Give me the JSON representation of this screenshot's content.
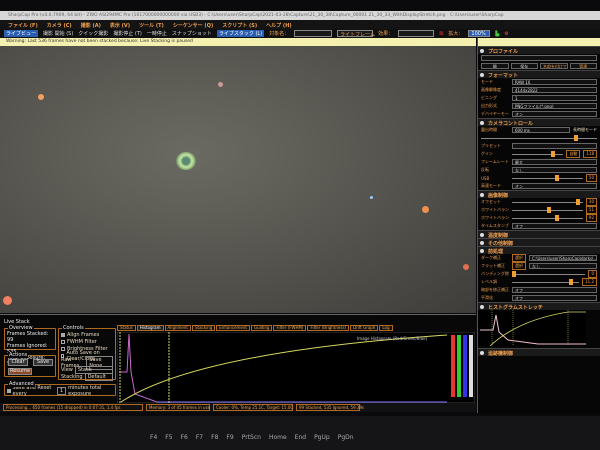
{
  "window": {
    "title": "SharpCap Pro (v4.0.7909, 64 bit) - ZWO ASI294MC Pro (1617000000000000 via USB3) - C:\\Users\\user\\SharpCap\\2021-03-28\\Capture\\21_30_38\\Capture_00001 21_30_33_WithDisplayStretch.png - C:\\Users\\user\\SharpCap"
  },
  "menu": [
    "ファイル (F)",
    "カメラ (C)",
    "撮影 (A)",
    "表示 (V)",
    "ツール (T)",
    "シーケンサー (Q)",
    "スクリプト (S)",
    "ヘルプ (H)"
  ],
  "toolbar": {
    "items": [
      "ライブビュー",
      "撮影 開始 (S)",
      "クイック撮影",
      "撮影停止 (T)",
      "一時停止",
      "スナップショット"
    ],
    "live_stack": "ライブスタック (L)",
    "target_label": "対象名：",
    "frame_type": "ライトフレーム",
    "effect_label": "効果：",
    "zoom_label": "拡大：",
    "zoom_value": "100%"
  },
  "warning": "Warning: Last 536 frames have not been stacked because: Live Stacking is paused",
  "right_panel": {
    "profile": {
      "title": "プロファイル",
      "buttons": [
        "開",
        "保存",
        "名前を付けて保存",
        "管理"
      ]
    },
    "format": {
      "title": "フォーマット",
      "rows": [
        [
          "モード",
          "RAW 16"
        ],
        [
          "画像解像度",
          "4144x2822"
        ],
        [
          "ビニング",
          "1"
        ],
        [
          "出力形式",
          "PNGファイル(*.png)"
        ],
        [
          "デバイヤーモード",
          "オン"
        ]
      ]
    },
    "camera": {
      "title": "カメラコントロール",
      "exposure_label": "露出時間",
      "exposure": "600 ms",
      "long_mode": "長時間モード",
      "preset": "プリセット",
      "gain_label": "ゲイン",
      "gain": "118",
      "gain_level": 0.75,
      "framerate_label": "フレームレート",
      "framerate": "最大",
      "flip_label": "反転",
      "flip": "なし",
      "usb_label": "USB",
      "usb": "50",
      "usb_level": 0.6,
      "hw_label": "高速モード",
      "hw": "オン",
      "auto": "自動"
    },
    "image": {
      "title": "画像制御",
      "offset_label": "オフセット",
      "offset": "30",
      "wb_r_label": "ホワイトバランス(R)",
      "wb_r": "51",
      "wb_b_label": "ホワイトバランス(B)",
      "wb_b": "92",
      "timestamp_label": "タイムスタンプ",
      "timestamp": "オフ"
    },
    "collapsed": [
      "温度制御",
      "その他制御"
    ],
    "preprocess": {
      "title": "前処理",
      "dark_label": "ダーク補正",
      "dark": "C:\\Users\\user\\SharpCap\\darks\\...",
      "flat_label": "フラット補正",
      "flat": "なし",
      "banding_label": "バンディング除去",
      "banding": "0",
      "banding_level": 0.0,
      "level_label": "レベル調",
      "level": "11.2",
      "level_level": 0.85,
      "bias_label": "暗部を修正補正",
      "bias": "オフ",
      "noise_label": "平滑化",
      "noise": "オフ",
      "select": "選択"
    },
    "histogram": {
      "title": "ヒストグラムストレッチ"
    },
    "last": "追跡機制御"
  },
  "live_stack": {
    "title": "Live Stack",
    "overview": {
      "title": "Overview",
      "stacked_label": "Frames Stacked:",
      "stacked": "99",
      "ignored_label": "Frames Ignored:",
      "ignored": "535",
      "exposure_label": "Total Exposure:",
      "exposure": "59.39s"
    },
    "actions": {
      "title": "Actions",
      "clear": "Clear",
      "save": "Save",
      "resume": "Resume"
    },
    "controls": {
      "title": "Controls",
      "checks": [
        {
          "label": "Align Frames",
          "checked": true
        },
        {
          "label": "FWHM Filter",
          "checked": false
        },
        {
          "label": "Brightness Filter",
          "checked": false
        },
        {
          "label": "Auto Save on Clear/Close",
          "checked": false
        }
      ],
      "raw_label": "Raw Frames",
      "raw": "Save None",
      "view_label": "View",
      "view": "Stack",
      "stacking_label": "Stacking",
      "stacking": "Default"
    },
    "advanced": {
      "title": "Advanced",
      "save_reset": "Save and Reset every",
      "minutes": "1",
      "suffix": "minutes total exposure"
    },
    "tabs": [
      "Status",
      "Histogram",
      "Alignment",
      "Stacking",
      "Enhancement",
      "Guiding",
      "Filter (FWHM)",
      "Filter (Brightness)",
      "Drift Graph",
      "Log"
    ],
    "active_tab": "Histogram",
    "hist_label": "Image Histogram (Red/Green/Blue)"
  },
  "status": [
    "Processing... 650 frames (15 dropped) in 0:07:31, 1.4 fps",
    "Memory: 3 of 45 frames in use",
    "Cooler: 0%, Temp 25.1C, Target: 15.0C",
    "99 Stacked, 535 Ignored, 59.39s"
  ],
  "keyboard": [
    "F4",
    "F5",
    "F6",
    "F7",
    "F8",
    "F9",
    "PrtScn",
    "Home",
    "End",
    "PgUp",
    "PgDn"
  ],
  "colors": {
    "accent": "#f0a050",
    "warning": "#f4f0b0",
    "live_stack_button": "#2a5db0",
    "curve": "#d8d860"
  }
}
